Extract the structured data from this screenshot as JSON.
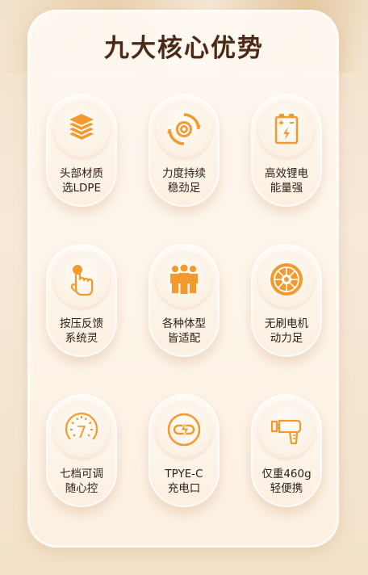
{
  "title": "九大核心优势",
  "features": [
    {
      "line1": "头部材质",
      "line2": "选LDPE",
      "icon": "layers-icon"
    },
    {
      "line1": "力度持续",
      "line2": "稳劲足",
      "icon": "power-cycle-icon"
    },
    {
      "line1": "高效锂电",
      "line2": "能量强",
      "icon": "battery-icon"
    },
    {
      "line1": "按压反馈",
      "line2": "系统灵",
      "icon": "press-finger-icon"
    },
    {
      "line1": "各种体型",
      "line2": "皆适配",
      "icon": "people-group-icon"
    },
    {
      "line1": "无刷电机",
      "line2": "动力足",
      "icon": "motor-icon"
    },
    {
      "line1": "七档可调",
      "line2": "随心控",
      "icon": "speed-gauge-icon"
    },
    {
      "line1": "TPYE-C",
      "line2": "充电口",
      "icon": "charge-plug-icon"
    },
    {
      "line1": "仅重460g",
      "line2": "轻便携",
      "icon": "massage-gun-icon"
    }
  ],
  "colors": {
    "accent": "#f29a2e",
    "title": "#4a2a14",
    "text": "#2d1e12"
  },
  "gauge_digit": "7"
}
